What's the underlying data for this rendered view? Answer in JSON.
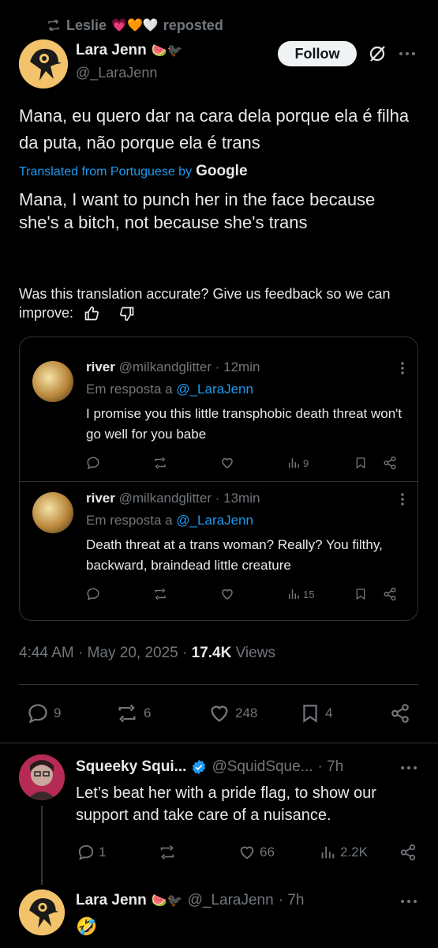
{
  "repost": {
    "user": "Leslie",
    "hearts": "💗🧡🤍",
    "label": "reposted"
  },
  "post": {
    "author_name": "Lara Jenn",
    "author_emojis": "🍉🐦‍⬛",
    "author_handle": "@_LaraJenn",
    "follow_label": "Follow",
    "text": "Mana, eu quero dar na cara dela porque ela é filha da puta, não porque ela é trans",
    "translated_label": "Translated from Portuguese by",
    "translator": "Google",
    "translation": "Mana, I want to punch her in the face because she's a bitch, not because she's trans",
    "feedback": "Was this translation accurate? Give us feedback so we can improve:",
    "timestamp": "4:44 AM · May 20, 2025 · ",
    "views_count": "17.4K",
    "views_label": " Views",
    "replies": "9",
    "reposts": "6",
    "likes": "248",
    "bookmarks": "4"
  },
  "quoted_replies": [
    {
      "name": "river",
      "handle": "@milkandglitter",
      "time": "· 12min",
      "reply_prefix": "Em resposta a",
      "reply_to": "@_LaraJenn",
      "text": "I promise you this little transphobic death threat won't go well for you babe",
      "views": "9"
    },
    {
      "name": "river",
      "handle": "@milkandglitter",
      "time": "· 13min",
      "reply_prefix": "Em resposta a",
      "reply_to": "@_LaraJenn",
      "text": "Death threat at a trans woman? Really? You filthy, backward, braindead little creature",
      "views": "15"
    }
  ],
  "reply": {
    "name": "Squeeky Squi...",
    "handle": "@SquidSque...",
    "time": "· 7h",
    "text": "Let’s beat her with a pride flag, to show our support and take care of a nuisance.",
    "replies": "1",
    "likes": "66",
    "views": "2.2K"
  },
  "reply2": {
    "name": "Lara Jenn",
    "emojis": "🍉🐦‍⬛",
    "handle": "@_LaraJenn",
    "time": "· 7h",
    "text": "🤣"
  },
  "colors": {
    "link": "#1d9bf0",
    "muted": "#71767b",
    "text": "#e7e9ea",
    "verified": "#1d9bf0"
  }
}
